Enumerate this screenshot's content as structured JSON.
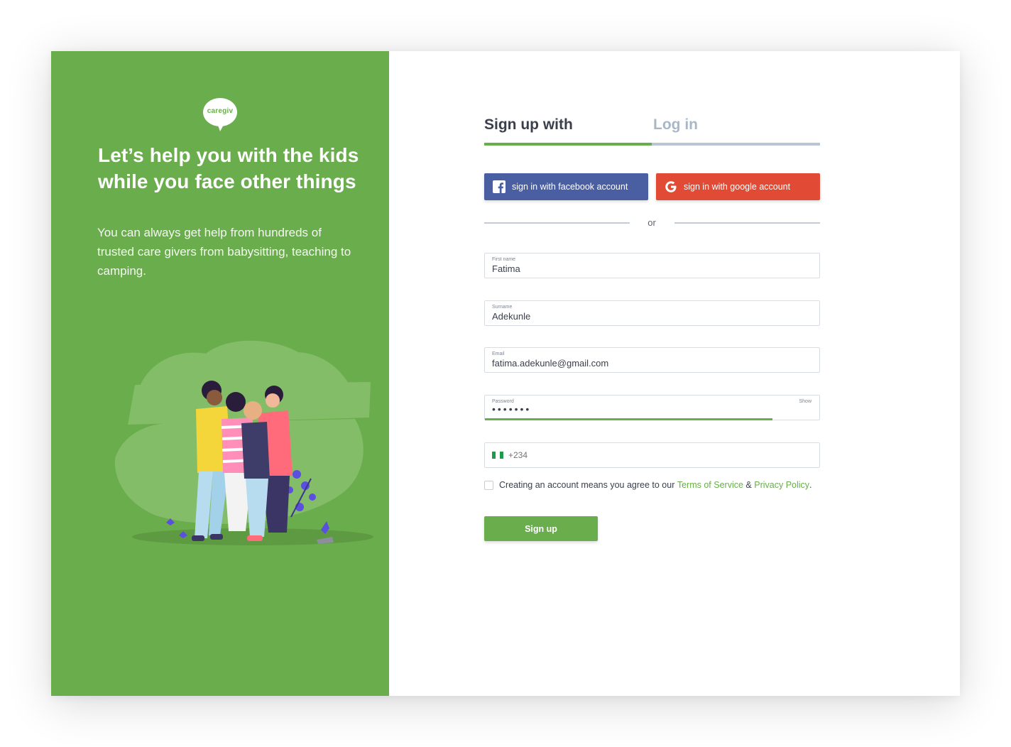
{
  "brand": {
    "logo_text": "caregiv"
  },
  "hero": {
    "headline": "Let’s help you with the kids while you face other things",
    "subtext": "You can always get help from hundreds of trusted care givers from babysitting, teaching to camping."
  },
  "tabs": {
    "signup": "Sign up with",
    "login": "Log in",
    "active": "signup"
  },
  "social": {
    "facebook_label": "sign in with facebook account",
    "google_label": "sign in with google account"
  },
  "divider": {
    "or": "or"
  },
  "form": {
    "first_name": {
      "label": "First name",
      "value": "Fatima"
    },
    "surname": {
      "label": "Surname",
      "value": "Adekunle"
    },
    "email": {
      "label": "Email",
      "value": "fatima.adekunle@gmail.com"
    },
    "password": {
      "label": "Password",
      "value": "•••••••",
      "toggle": "Show"
    },
    "phone": {
      "placeholder": "+234",
      "country_colors": [
        "#1f9a4b",
        "#ffffff",
        "#1f9a4b"
      ]
    }
  },
  "terms": {
    "prefix": "Creating an account means you agree to our ",
    "terms_link": "Terms of Service",
    "joiner": " & ",
    "privacy_link": "Privacy Policy",
    "suffix": "."
  },
  "submit": {
    "label": "Sign up"
  },
  "colors": {
    "brand_green": "#6aad4c",
    "facebook_blue": "#4a5fa2",
    "google_red": "#e14a34"
  }
}
